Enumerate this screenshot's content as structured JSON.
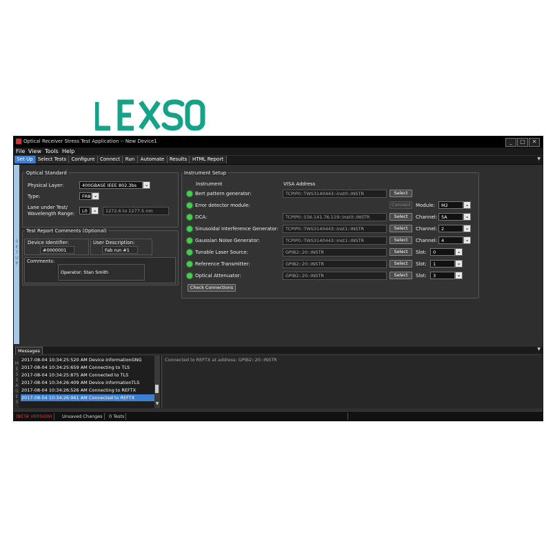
{
  "logo": {
    "text": "LEXSO",
    "color": "#14a389"
  },
  "window": {
    "title": "Optical Receiver Stress Test Application -- New Device1",
    "controls": [
      "_",
      "□",
      "✕"
    ]
  },
  "menu": [
    "File",
    "View",
    "Tools",
    "Help"
  ],
  "tabs": [
    "Set Up",
    "Select Tests",
    "Configure",
    "Connect",
    "Run",
    "Automate",
    "Results",
    "HTML Report"
  ],
  "sidebar_label": "SET UP",
  "optical_standard": {
    "title": "Optical Standard",
    "physical_layer_label": "Physical Layer:",
    "physical_layer_value": "400GBASE IEEE 802.3bs",
    "type_label": "Type:",
    "type_value": "FR8",
    "lane_label_1": "Lane under Test/",
    "lane_label_2": "Wavelength Range:",
    "lane_value": "L0",
    "wavelength_range": "1272.6 to 1277.5 nm"
  },
  "report_comments": {
    "title": "Test Report Comments (Optional)",
    "device_id_label": "Device Identifier:",
    "device_id_value": "#0000001",
    "user_desc_label": "User Description:",
    "user_desc_value": "Fab run #1",
    "comments_label": "Comments:",
    "comments_value": "Operator: Stan Smith"
  },
  "instrument_setup": {
    "title": "Instrument Setup",
    "col_instrument": "Instrument",
    "col_visa": "VISA Address",
    "rows": [
      {
        "name": "Bert pattern generator:",
        "address": "TCPIP0::TWS3140443::inst0::INSTR",
        "button": "Select",
        "extra_label": "",
        "extra_value": ""
      },
      {
        "name": "Error detector module:",
        "address": "",
        "button": "Connect",
        "extra_label": "Module:",
        "extra_value": "M2"
      },
      {
        "name": "DCA:",
        "address": "TCPIP0::156.141.76.119::inst0::INSTR",
        "button": "Select",
        "extra_label": "Channel:",
        "extra_value": "5A"
      },
      {
        "name": "Sinusoidal Interference Generator:",
        "address": "TCPIP0::TWS3140443::inst1::INSTR",
        "button": "Select",
        "extra_label": "Channel:",
        "extra_value": "2"
      },
      {
        "name": "Gaussian Noise Generator:",
        "address": "TCPIP0::TWS3140443::inst1::INSTR",
        "button": "Select",
        "extra_label": "Channel:",
        "extra_value": "4"
      },
      {
        "name": "Tunable Laser Source:",
        "address": "GPIB2::20::INSTR",
        "button": "Select",
        "extra_label": "Slot:",
        "extra_value": "0"
      },
      {
        "name": "Reference Transmitter:",
        "address": "GPIB2::20::INSTR",
        "button": "Select",
        "extra_label": "Slot:",
        "extra_value": "1"
      },
      {
        "name": "Optical Attenuator:",
        "address": "GPIB2::20::INSTR",
        "button": "Select",
        "extra_label": "Slot:",
        "extra_value": "3"
      }
    ],
    "check_button": "Check Connections"
  },
  "messages": {
    "tab_label": "Messages",
    "side_label": "MESSAGES",
    "rows": [
      "2017-08-04 10:34:25:520 AM Device informationGNG",
      "2017-08-04 10:34:25:659 AM Connecting to TLS",
      "2017-08-04 10:34:25:875 AM Connected to TLS",
      "2017-08-04 10:34:26:409 AM Device informationTLS",
      "2017-08-04 10:34:26:526 AM Connecting to REFTX",
      "2017-08-04 10:34:26:961 AM Connected to REFTX"
    ],
    "detail": "Connected to REFTX at address: GPIB2::20::INSTR"
  },
  "status": {
    "beta": "(BETA VERSION)",
    "changes": "Unsaved Changes",
    "tests": "0 Tests"
  }
}
